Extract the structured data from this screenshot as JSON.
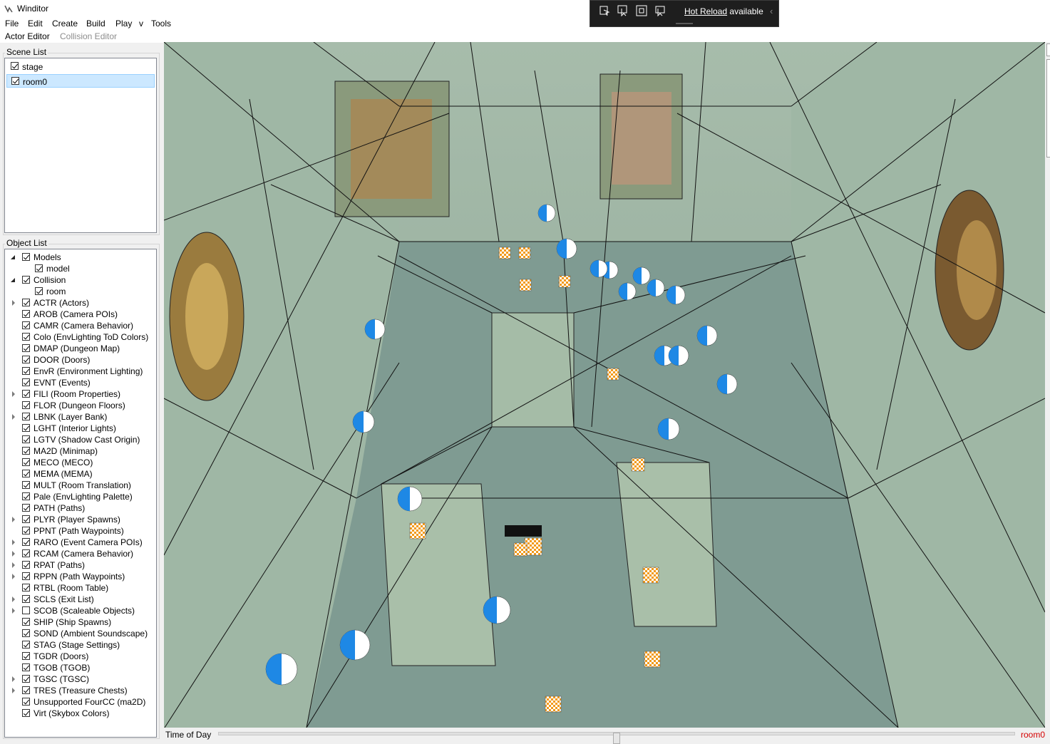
{
  "window": {
    "title": "Winditor"
  },
  "menu": [
    "File",
    "Edit",
    "Create",
    "Build",
    "Play",
    "v",
    "Tools"
  ],
  "submenu": {
    "actor_editor": "Actor Editor",
    "collision_editor": "Collision Editor"
  },
  "hot_reload": {
    "link": "Hot Reload",
    "suffix": "available"
  },
  "scene_list": {
    "label": "Scene List",
    "items": [
      {
        "label": "stage",
        "checked": true,
        "selected": false
      },
      {
        "label": "room0",
        "checked": true,
        "selected": true
      }
    ]
  },
  "object_list": {
    "label": "Object List",
    "items": [
      {
        "label": "Models",
        "checked": true,
        "depth": 0,
        "expander": "open"
      },
      {
        "label": "model",
        "checked": true,
        "depth": 1,
        "expander": "none"
      },
      {
        "label": "Collision",
        "checked": true,
        "depth": 0,
        "expander": "open"
      },
      {
        "label": "room",
        "checked": true,
        "depth": 1,
        "expander": "none"
      },
      {
        "label": "ACTR (Actors)",
        "checked": true,
        "depth": 0,
        "expander": "closed"
      },
      {
        "label": "AROB (Camera POIs)",
        "checked": true,
        "depth": 0,
        "expander": "none"
      },
      {
        "label": "CAMR (Camera Behavior)",
        "checked": true,
        "depth": 0,
        "expander": "none"
      },
      {
        "label": "Colo (EnvLighting ToD Colors)",
        "checked": true,
        "depth": 0,
        "expander": "none"
      },
      {
        "label": "DMAP (Dungeon Map)",
        "checked": true,
        "depth": 0,
        "expander": "none"
      },
      {
        "label": "DOOR (Doors)",
        "checked": true,
        "depth": 0,
        "expander": "none"
      },
      {
        "label": "EnvR (Environment Lighting)",
        "checked": true,
        "depth": 0,
        "expander": "none"
      },
      {
        "label": "EVNT (Events)",
        "checked": true,
        "depth": 0,
        "expander": "none"
      },
      {
        "label": "FILI (Room Properties)",
        "checked": true,
        "depth": 0,
        "expander": "closed"
      },
      {
        "label": "FLOR (Dungeon Floors)",
        "checked": true,
        "depth": 0,
        "expander": "none"
      },
      {
        "label": "LBNK (Layer Bank)",
        "checked": true,
        "depth": 0,
        "expander": "closed"
      },
      {
        "label": "LGHT (Interior Lights)",
        "checked": true,
        "depth": 0,
        "expander": "none"
      },
      {
        "label": "LGTV (Shadow Cast Origin)",
        "checked": true,
        "depth": 0,
        "expander": "none"
      },
      {
        "label": "MA2D (Minimap)",
        "checked": true,
        "depth": 0,
        "expander": "none"
      },
      {
        "label": "MECO (MECO)",
        "checked": true,
        "depth": 0,
        "expander": "none"
      },
      {
        "label": "MEMA (MEMA)",
        "checked": true,
        "depth": 0,
        "expander": "none"
      },
      {
        "label": "MULT (Room Translation)",
        "checked": true,
        "depth": 0,
        "expander": "none"
      },
      {
        "label": "Pale (EnvLighting Palette)",
        "checked": true,
        "depth": 0,
        "expander": "none"
      },
      {
        "label": "PATH (Paths)",
        "checked": true,
        "depth": 0,
        "expander": "none"
      },
      {
        "label": "PLYR (Player Spawns)",
        "checked": true,
        "depth": 0,
        "expander": "closed"
      },
      {
        "label": "PPNT (Path Waypoints)",
        "checked": true,
        "depth": 0,
        "expander": "none"
      },
      {
        "label": "RARO (Event Camera POIs)",
        "checked": true,
        "depth": 0,
        "expander": "closed"
      },
      {
        "label": "RCAM (Camera Behavior)",
        "checked": true,
        "depth": 0,
        "expander": "closed"
      },
      {
        "label": "RPAT (Paths)",
        "checked": true,
        "depth": 0,
        "expander": "closed"
      },
      {
        "label": "RPPN (Path Waypoints)",
        "checked": true,
        "depth": 0,
        "expander": "closed"
      },
      {
        "label": "RTBL (Room Table)",
        "checked": true,
        "depth": 0,
        "expander": "none"
      },
      {
        "label": "SCLS (Exit List)",
        "checked": true,
        "depth": 0,
        "expander": "closed"
      },
      {
        "label": "SCOB (Scaleable Objects)",
        "checked": false,
        "depth": 0,
        "expander": "closed"
      },
      {
        "label": "SHIP (Ship Spawns)",
        "checked": true,
        "depth": 0,
        "expander": "none"
      },
      {
        "label": "SOND (Ambient Soundscape)",
        "checked": true,
        "depth": 0,
        "expander": "none"
      },
      {
        "label": "STAG (Stage Settings)",
        "checked": true,
        "depth": 0,
        "expander": "none"
      },
      {
        "label": "TGDR (Doors)",
        "checked": true,
        "depth": 0,
        "expander": "none"
      },
      {
        "label": "TGOB (TGOB)",
        "checked": true,
        "depth": 0,
        "expander": "none"
      },
      {
        "label": "TGSC (TGSC)",
        "checked": true,
        "depth": 0,
        "expander": "closed"
      },
      {
        "label": "TRES (Treasure Chests)",
        "checked": true,
        "depth": 0,
        "expander": "closed"
      },
      {
        "label": "Unsupported FourCC (ma2D)",
        "checked": true,
        "depth": 0,
        "expander": "none"
      },
      {
        "label": "Virt (Skybox Colors)",
        "checked": true,
        "depth": 0,
        "expander": "none"
      }
    ]
  },
  "status_bar": {
    "time_of_day_label": "Time of Day",
    "time_of_day_value": 0.5,
    "current_room": "room0"
  },
  "viewport": {
    "content": "3D scene with collision wireframe, actor markers and waypoint cubes"
  },
  "colors": {
    "marker_blue": "#1e88e5",
    "marker_orange": "#f39c12",
    "status_red": "#d40000",
    "selection": "#cce8ff"
  }
}
